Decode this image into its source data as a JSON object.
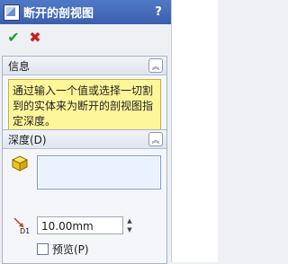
{
  "header": {
    "title": "断开的剖视图",
    "help_label": "?"
  },
  "actions": {
    "ok_glyph": "✔",
    "cancel_glyph": "✖"
  },
  "info_group": {
    "title": "信息",
    "collapse_glyph": "︽",
    "message": "通过输入一个值或选择一切割到的实体来为断开的剖视图指定深度。"
  },
  "depth_group": {
    "title": "深度(D)",
    "collapse_glyph": "︽",
    "depth_value": "10.00mm",
    "depth_icon_label": "D1",
    "preview_label": "预览(P)",
    "preview_checked": false
  },
  "colors": {
    "header_bg": "#3f66b4",
    "info_bg": "#fff69a",
    "selection_bg": "#eaf2ff"
  },
  "icons": [
    "feature-icon",
    "help-icon",
    "ok-icon",
    "cancel-icon",
    "collapse-icon",
    "cube-icon",
    "depth-icon"
  ]
}
